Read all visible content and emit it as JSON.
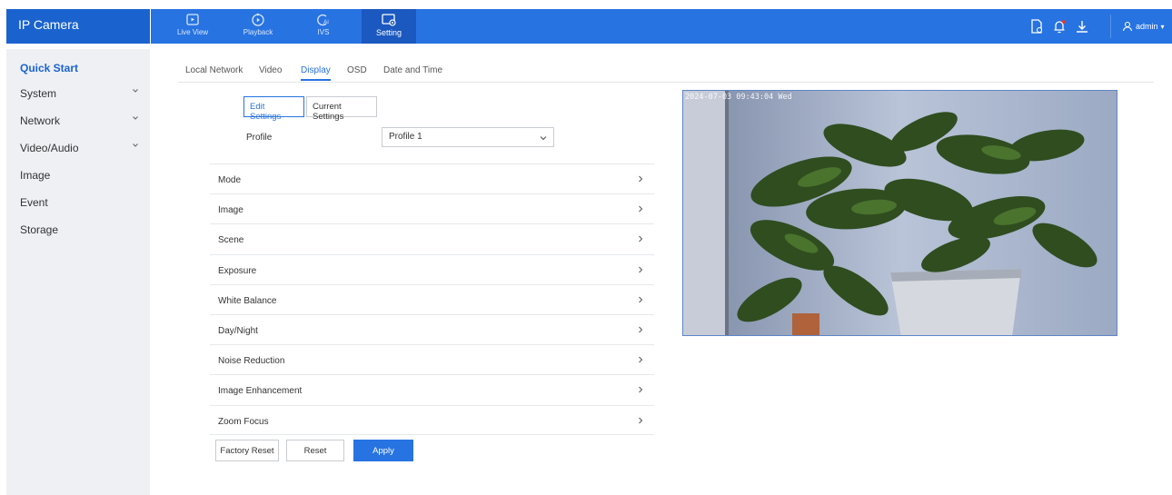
{
  "app": {
    "title": "IP Camera"
  },
  "nav": {
    "items": [
      {
        "label": "Live View",
        "icon": "live-view-icon"
      },
      {
        "label": "Playback",
        "icon": "playback-icon"
      },
      {
        "label": "IVS",
        "icon": "ivs-icon"
      },
      {
        "label": "Setting",
        "icon": "setting-icon",
        "active": true
      }
    ]
  },
  "header": {
    "icons": [
      "document-icon",
      "bell-icon",
      "download-icon"
    ],
    "user": "admin",
    "user_caret": "▾"
  },
  "sidebar": {
    "items": [
      {
        "label": "Quick Start",
        "active": true
      },
      {
        "label": "System",
        "expandable": true
      },
      {
        "label": "Network",
        "expandable": true
      },
      {
        "label": "Video/Audio",
        "expandable": true
      },
      {
        "label": "Image"
      },
      {
        "label": "Event"
      },
      {
        "label": "Storage"
      }
    ]
  },
  "tabs": {
    "items": [
      {
        "label": "Local Network"
      },
      {
        "label": "Video"
      },
      {
        "label": "Display",
        "active": true
      },
      {
        "label": "OSD"
      },
      {
        "label": "Date and Time"
      }
    ]
  },
  "settings_toggle": {
    "edit": "Edit Settings",
    "current": "Current Settings"
  },
  "profile": {
    "label": "Profile",
    "value": "Profile 1"
  },
  "sections": [
    "Mode",
    "Image",
    "Scene",
    "Exposure",
    "White Balance",
    "Day/Night",
    "Noise Reduction",
    "Image Enhancement",
    "Zoom Focus"
  ],
  "buttons": {
    "factory_reset": "Factory Reset",
    "reset": "Reset",
    "apply": "Apply"
  },
  "preview": {
    "timestamp": "2024-07-03 09:43:04 Wed"
  },
  "colors": {
    "brand": "#1a63cf",
    "nav": "#2773e2",
    "sidebar": "#eef0f4",
    "accent": "#2773e2"
  }
}
